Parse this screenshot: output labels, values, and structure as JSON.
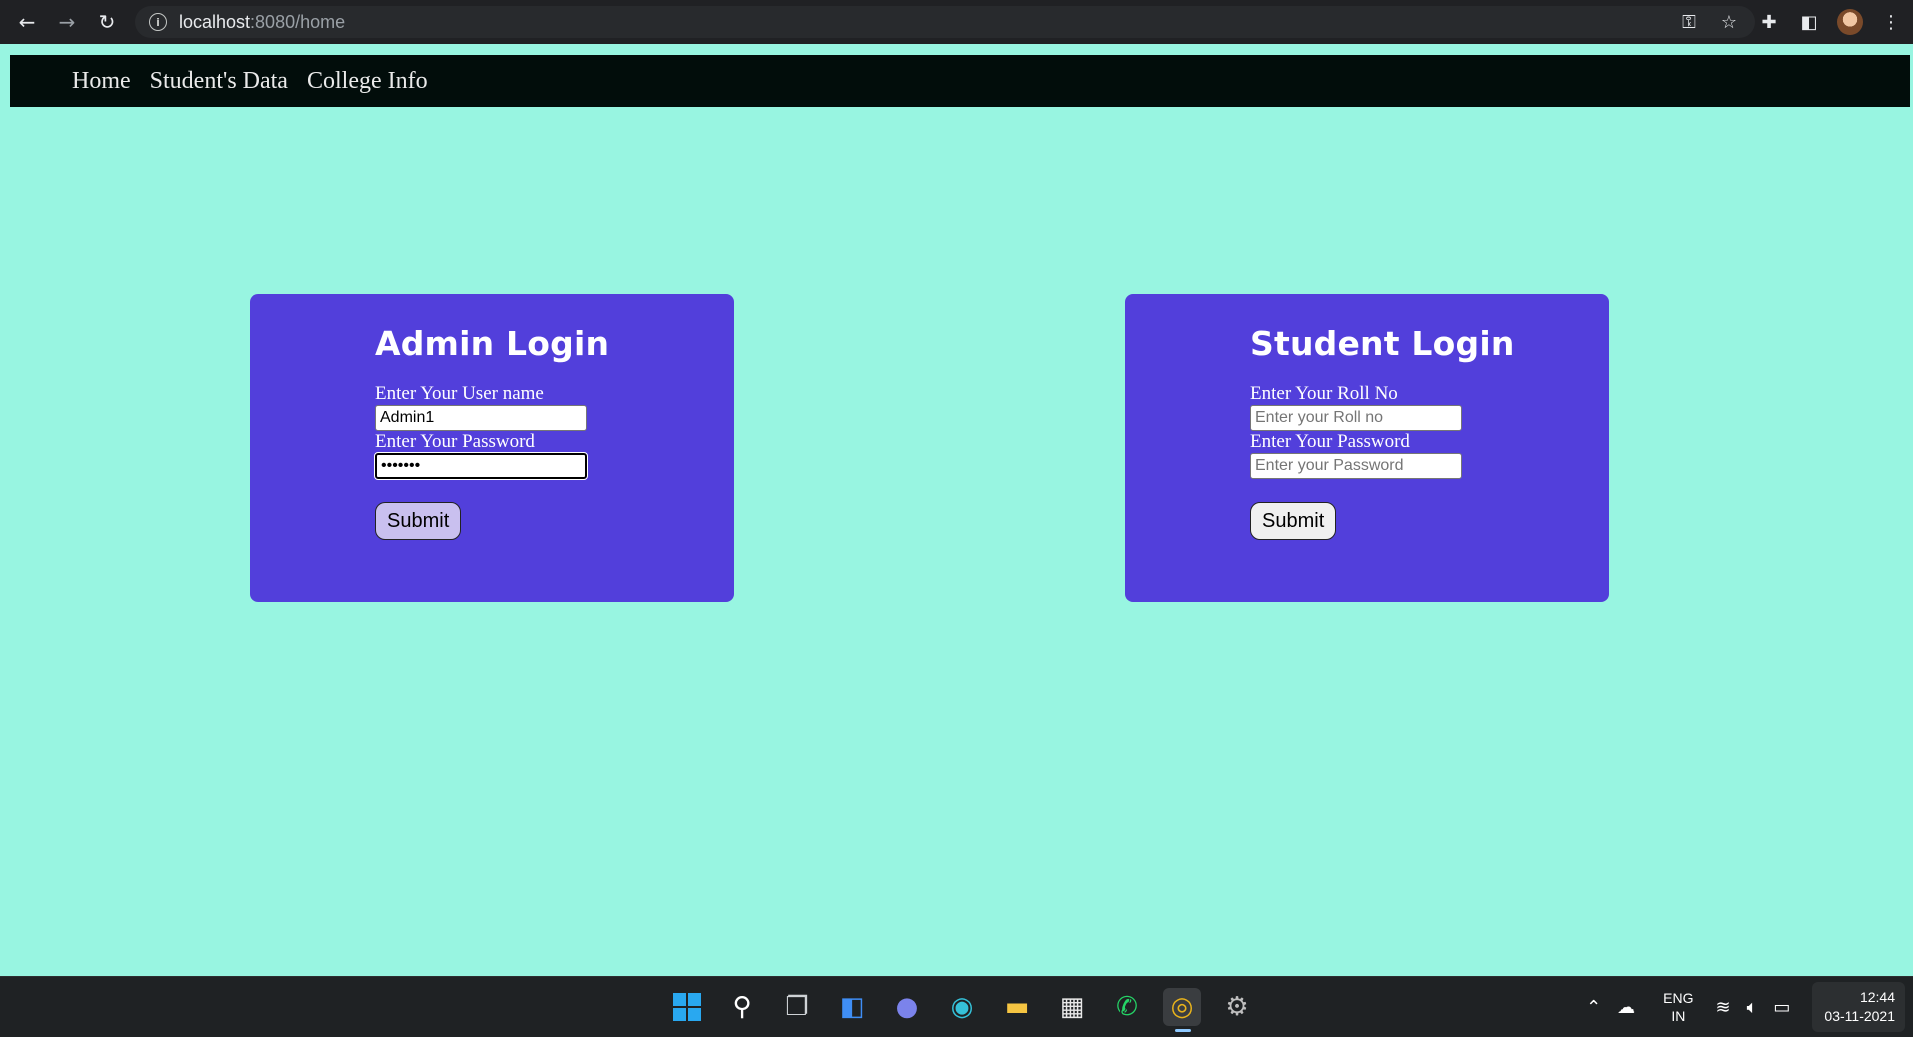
{
  "browser": {
    "url_host": "localhost",
    "url_path": ":8080/home"
  },
  "nav": {
    "items": [
      {
        "label": "Home"
      },
      {
        "label": "Student's Data"
      },
      {
        "label": "College Info"
      }
    ]
  },
  "admin_login": {
    "title": "Admin Login",
    "username_label": "Enter Your User name",
    "username_value": "Admin1",
    "password_label": "Enter Your Password",
    "password_value": "•••••••",
    "submit_label": "Submit"
  },
  "student_login": {
    "title": "Student Login",
    "rollno_label": "Enter Your Roll No",
    "rollno_placeholder": "Enter your Roll no",
    "password_label": "Enter Your Password",
    "password_placeholder": "Enter your Password",
    "submit_label": "Submit"
  },
  "taskbar": {
    "lang_primary": "ENG",
    "lang_secondary": "IN",
    "time": "12:44",
    "date": "03-11-2021"
  }
}
